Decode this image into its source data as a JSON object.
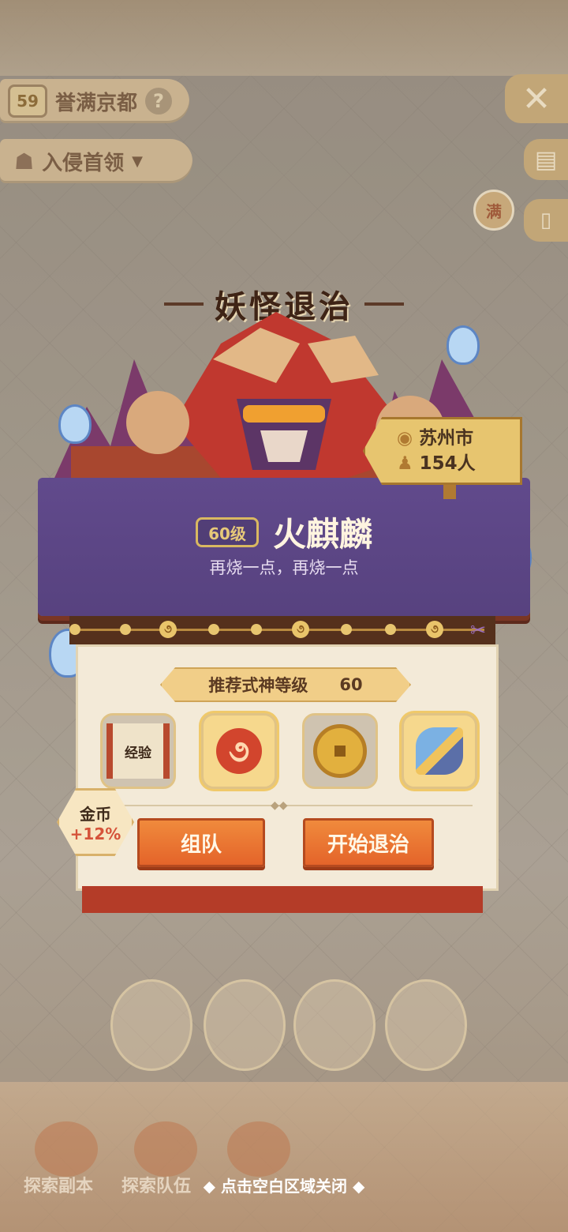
{
  "header": {
    "level": "59",
    "city_title": "誉满京都",
    "mode_label": "入侵首领",
    "full_badge": "满"
  },
  "event": {
    "title": "妖怪退治"
  },
  "boss": {
    "level_label": "60级",
    "name": "火麒麟",
    "quote": "再烧一点，再烧一点"
  },
  "location": {
    "city": "苏州市",
    "players": "154人"
  },
  "recommend": {
    "label": "推荐式神等级",
    "value": "60"
  },
  "rewards": {
    "exp_label": "经验",
    "icons": [
      "exp-scroll-icon",
      "magatama-swirl-icon",
      "gold-coin-icon",
      "paper-bird-icon"
    ]
  },
  "bonus": {
    "label": "金币",
    "value": "+12%"
  },
  "buttons": {
    "team": "组队",
    "start": "开始退治"
  },
  "bottom_nav": {
    "explore_dungeon": "探索副本",
    "explore_team": "探索队伍",
    "close_hint": "◆ 点击空白区域关闭 ◆"
  },
  "colors": {
    "banner_purple": "#614a8c",
    "button_orange": "#e4642a",
    "title_brown": "#3f2416"
  }
}
